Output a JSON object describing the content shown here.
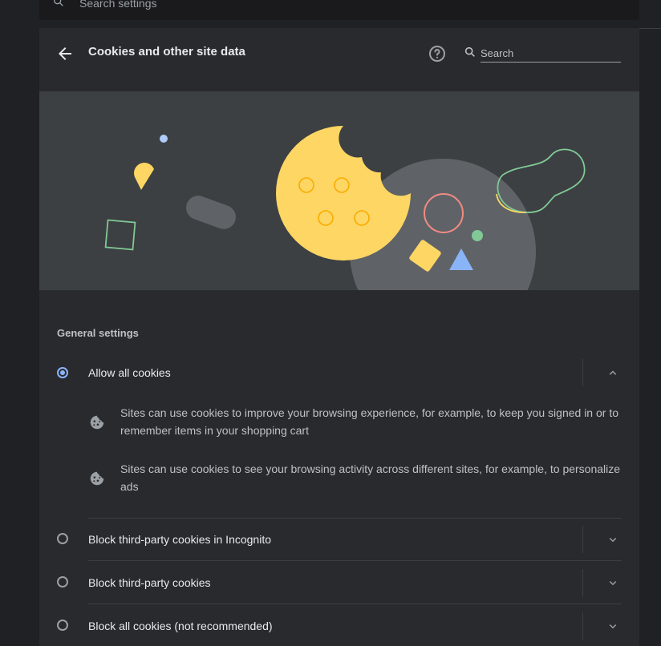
{
  "top_search": {
    "placeholder": "Search settings"
  },
  "header": {
    "title": "Cookies and other site data",
    "search_placeholder": "Search"
  },
  "section_title": "General settings",
  "options": [
    {
      "label": "Allow all cookies",
      "selected": true,
      "expanded": true,
      "details": [
        "Sites can use cookies to improve your browsing experience, for example, to keep you signed in or to remember items in your shopping cart",
        "Sites can use cookies to see your browsing activity across different sites, for example, to personalize ads"
      ]
    },
    {
      "label": "Block third-party cookies in Incognito",
      "selected": false,
      "expanded": false
    },
    {
      "label": "Block third-party cookies",
      "selected": false,
      "expanded": false
    },
    {
      "label": "Block all cookies (not recommended)",
      "selected": false,
      "expanded": false
    }
  ],
  "colors": {
    "background": "#202124",
    "card": "#292a2d",
    "banner": "#3c4043",
    "accent": "#8ab4f8",
    "cookie_yellow": "#fdd663",
    "cookie_gray": "#5f6368"
  },
  "icons": {
    "back": "arrow-back-icon",
    "help": "help-icon",
    "search": "search-icon",
    "detail": "cookie-icon",
    "expand": "chevron-down-icon",
    "collapse": "chevron-up-icon"
  }
}
